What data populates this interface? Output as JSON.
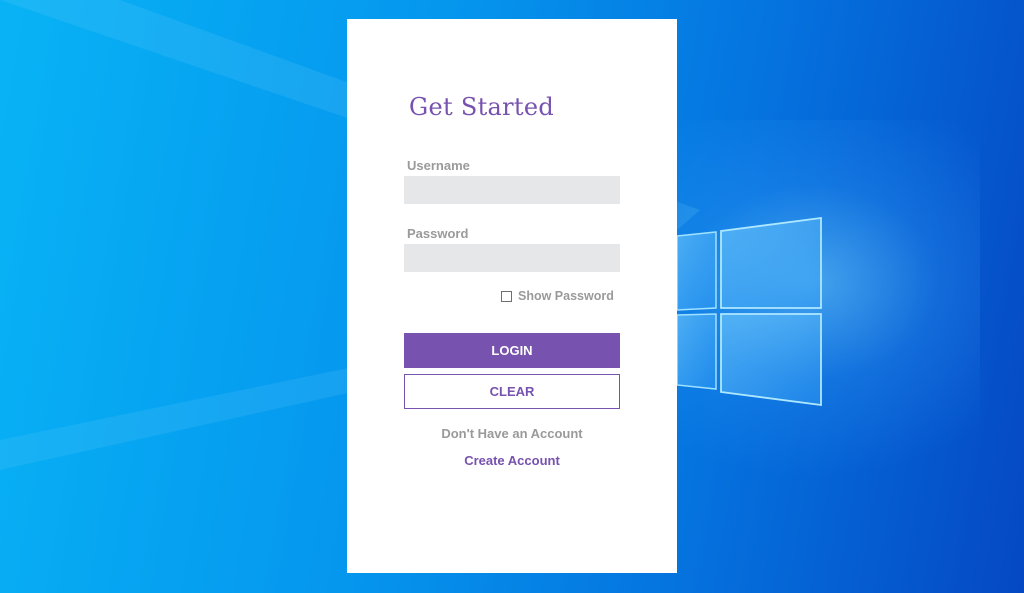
{
  "window": {
    "title": "Get Started"
  },
  "form": {
    "username_label": "Username",
    "username_value": "",
    "password_label": "Password",
    "password_value": "",
    "show_password_label": "Show Password",
    "show_password_checked": false
  },
  "actions": {
    "login_label": "LOGIN",
    "clear_label": "CLEAR"
  },
  "footer": {
    "no_account_text": "Don't Have an Account",
    "create_account_link": "Create Account"
  },
  "colors": {
    "accent": "#7752ae",
    "muted_text": "#9a9a9a",
    "input_bg": "#e6e7e8",
    "panel_bg": "#ffffff"
  }
}
